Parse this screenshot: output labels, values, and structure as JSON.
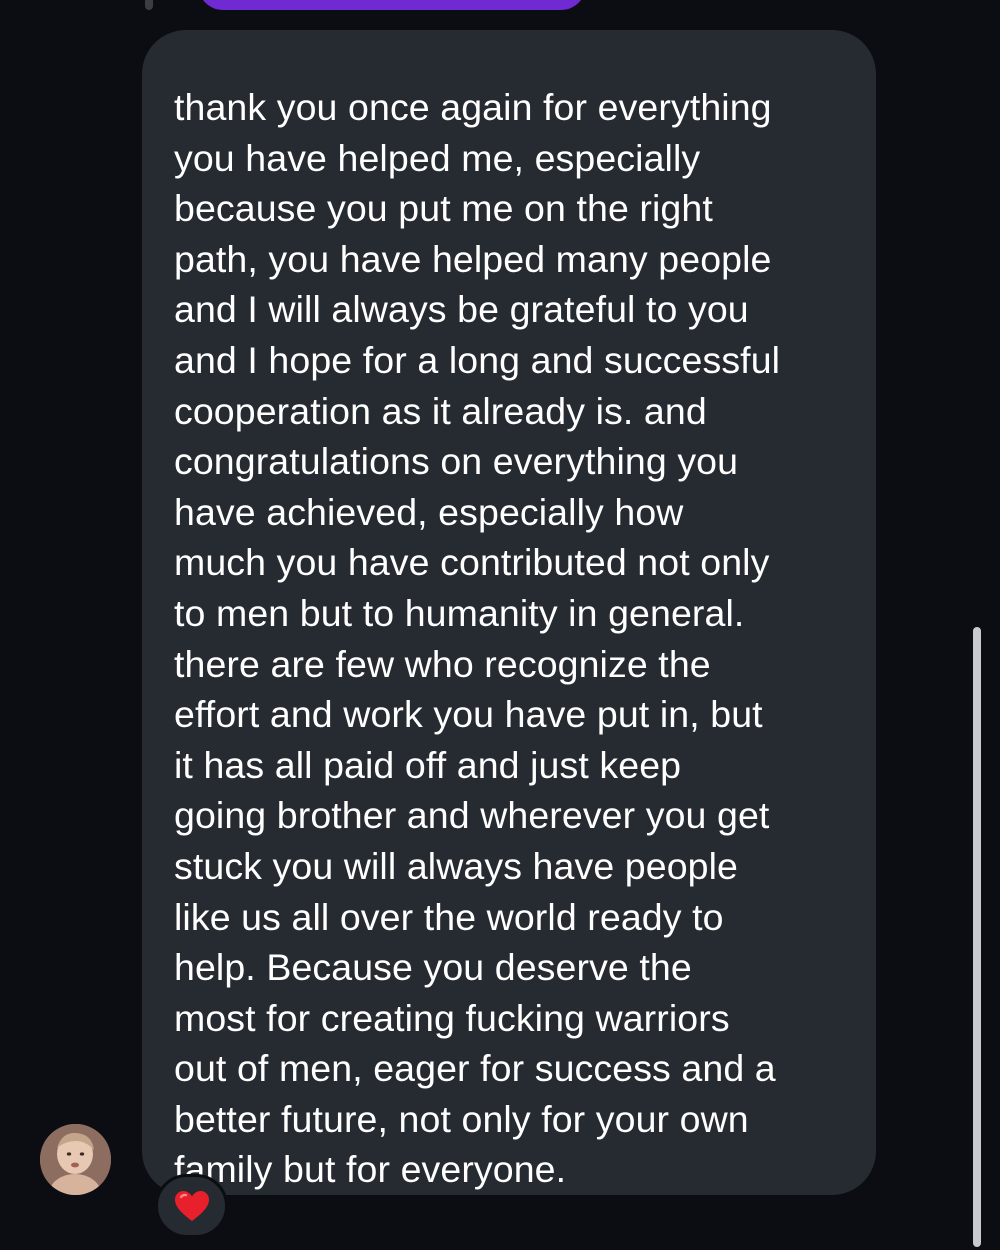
{
  "message": {
    "lines": [
      "thank you once again for everything",
      "you have helped me, especially",
      "because you put me on the right",
      "path, you have helped many people",
      "and I will always be grateful to you",
      "and I hope for a long and successful",
      "cooperation as it already is. and",
      "congratulations on everything you",
      "have achieved, especially how",
      "much you have contributed not only",
      "to men but to humanity in general.",
      "there are few who recognize the",
      "effort and work you have put in, but",
      "it has all paid off and just keep",
      "going brother and wherever you get",
      "stuck you will always have people",
      "like us all over the world ready to",
      "help. Because you deserve the",
      "most for creating fucking warriors",
      "out of men, eager for success and a",
      "better future, not only for your own",
      "family but for everyone."
    ]
  },
  "reaction": {
    "icon": "heart-icon",
    "color": "#e8202c"
  },
  "colors": {
    "background": "#0b0d12",
    "bubble": "#262a31",
    "text": "#ffffff",
    "previous_bubble": "#6f2bd1",
    "scrollbar": "#c9cacf"
  }
}
